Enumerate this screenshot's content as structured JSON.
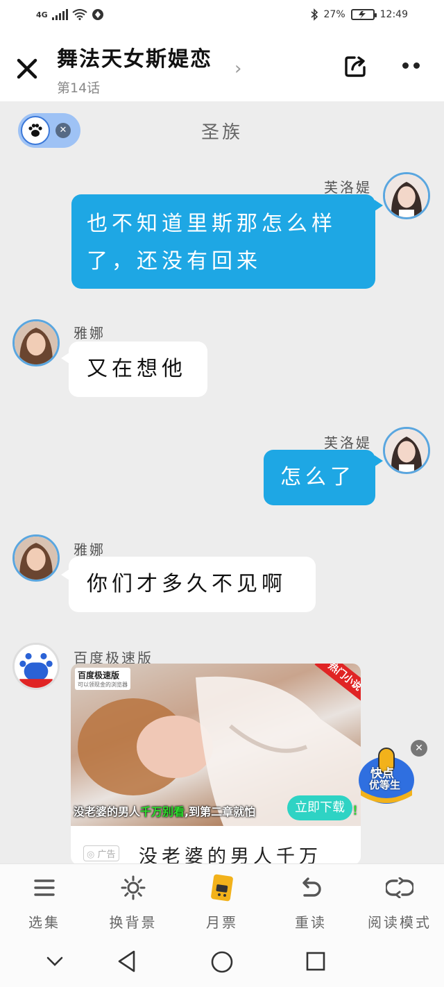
{
  "status_bar": {
    "network": "4G",
    "battery": "27%",
    "time": "12:49"
  },
  "header": {
    "title": "舞法天女斯媞恋",
    "subtitle": "第14话"
  },
  "chat": {
    "chapter_label": "圣族",
    "messages": [
      {
        "side": "right",
        "speaker": "芙洛媞",
        "lines": [
          "也不知道里斯那怎么样",
          "了，还没有回来"
        ]
      },
      {
        "side": "left",
        "speaker": "雅娜",
        "text": "又在想他"
      },
      {
        "side": "right",
        "speaker": "芙洛媞",
        "text": "怎么了"
      },
      {
        "side": "left",
        "speaker": "雅娜",
        "text": "你们才多久不见啊"
      }
    ]
  },
  "ad": {
    "sender": "百度极速版",
    "logo_text": "百度极速版",
    "logo_sub": "可以领现金的浏览器",
    "ribbon": "热门小说",
    "caption_pre": "没老婆的男人",
    "caption_hl": "千万别看",
    "caption_post": ",到第二章就怕",
    "caption_end": "！",
    "download_label": "立即下载",
    "tag": "广告",
    "title": "没老婆的男人千万"
  },
  "floating_badge": {
    "line1": "快点",
    "line2": "优等生"
  },
  "toolbar": {
    "items": [
      {
        "label": "选集",
        "icon": "menu-icon"
      },
      {
        "label": "换背景",
        "icon": "sun-icon"
      },
      {
        "label": "月票",
        "icon": "ticket-icon"
      },
      {
        "label": "重读",
        "icon": "undo-icon"
      },
      {
        "label": "阅读模式",
        "icon": "loop-icon"
      }
    ]
  },
  "colors": {
    "bubble_blue": "#1ea7e4",
    "background": "#ededed",
    "avatar_ring": "#5aa6df"
  }
}
